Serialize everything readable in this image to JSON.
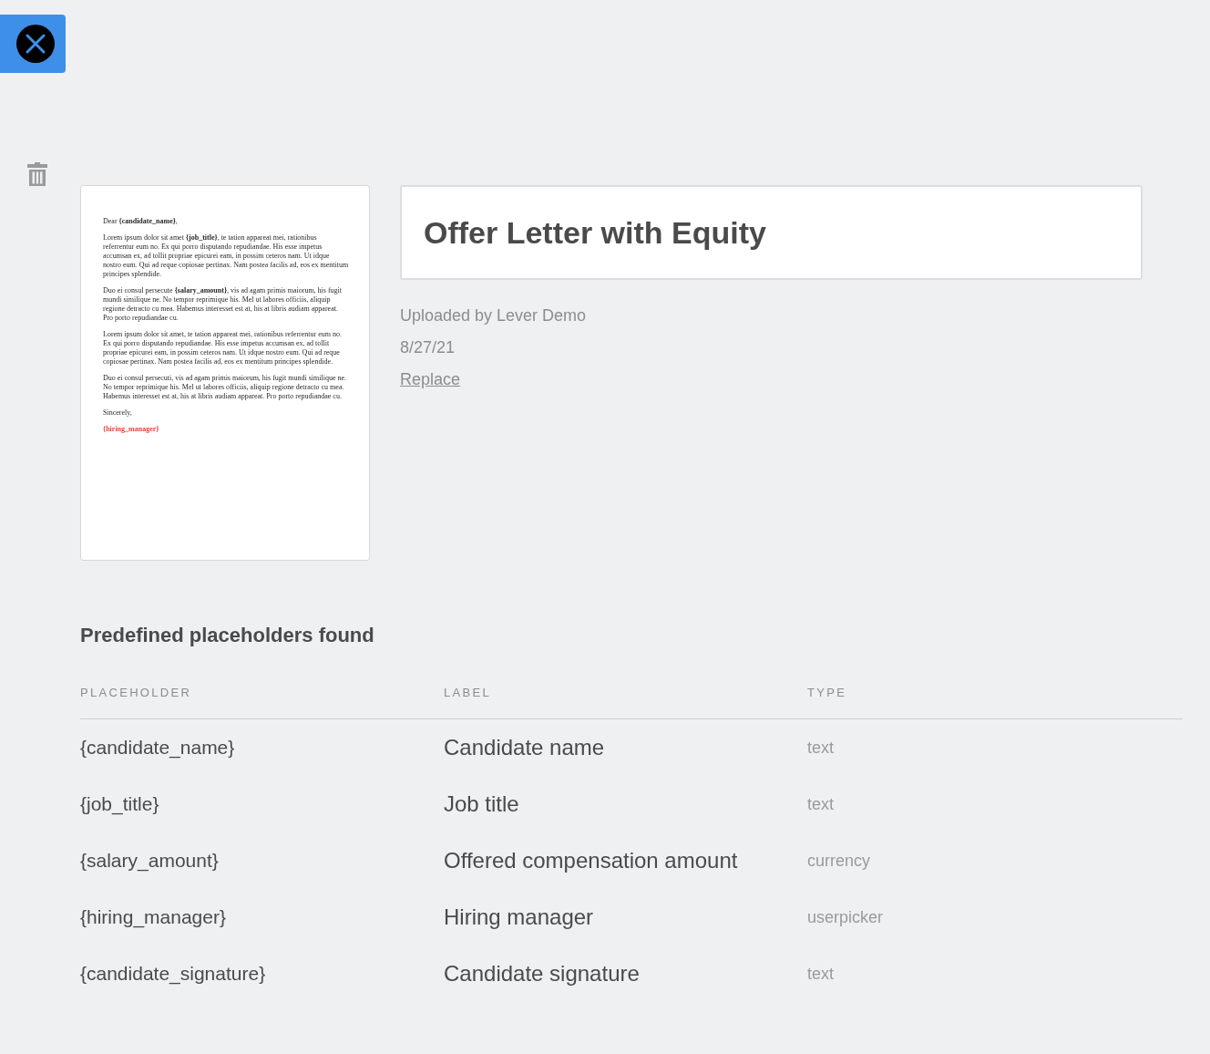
{
  "document_preview": {
    "paragraphs": [
      {
        "kind": "text",
        "text": "Dear **{candidate_name}**,"
      },
      {
        "kind": "text",
        "text": "Lorem ipsum dolor sit amet **{job_title}**, te tation appareat mei, rationibus referrentur eum no. Ex qui porro disputando repudiandae. His esse impetus accumsan ex, ad tollit propriae epicurei eam, in possim ceteros nam. Ut idque nostro eum. Qui ad reque copiosae pertinax. Nam postea facilis ad, eos ex mentitum principes splendide."
      },
      {
        "kind": "text",
        "text": "Duo ei consul persecute **{salary_amount}**, vis ad agam primis maiorum, his fugit mundi similique ne. No tempor reprimique his. Mel ut labores officiis, aliquip regione detracto cu mea. Habemus interesset est at, his at libris audiam appareat. Pro porto repudiandae cu."
      },
      {
        "kind": "text",
        "text": "Lorem ipsum dolor sit amet, te tation appareat mei, rationibus referrentur eum no. Ex qui porro disputando repudiandae. His esse impetus accumsan ex, ad tollit propriae epicurei eam, in possim ceteros nam. Ut idque nostro eum. Qui ad reque copiosae pertinax. Nam postea facilis ad, eos ex mentitum principes splendide."
      },
      {
        "kind": "text",
        "text": "Duo ei consul persecuti, vis ad agam primis maiorum, his fugit mundi similique ne. No tempor reprimique his. Mel ut labores officiis, aliquip regione detracto cu mea. Habemus interesset est at, his at libris audiam appareat. Pro porto repudiandae cu."
      },
      {
        "kind": "text",
        "text": "Sincerely,"
      },
      {
        "kind": "placeholder",
        "text": "{hiring_manager}"
      }
    ]
  },
  "title_field": {
    "value": "Offer Letter with Equity"
  },
  "meta": {
    "uploaded_by": "Uploaded by Lever Demo",
    "date": "8/27/21",
    "replace_link": "Replace"
  },
  "placeholders_section": {
    "heading": "Predefined placeholders found",
    "columns": [
      "PLACEHOLDER",
      "LABEL",
      "TYPE"
    ],
    "rows": [
      {
        "placeholder": "{candidate_name}",
        "label": "Candidate name",
        "type": "text"
      },
      {
        "placeholder": "{job_title}",
        "label": "Job title",
        "type": "text"
      },
      {
        "placeholder": "{salary_amount}",
        "label": "Offered compensation amount",
        "type": "currency"
      },
      {
        "placeholder": "{hiring_manager}",
        "label": "Hiring manager",
        "type": "userpicker"
      },
      {
        "placeholder": "{candidate_signature}",
        "label": "Candidate signature",
        "type": "text"
      }
    ]
  }
}
